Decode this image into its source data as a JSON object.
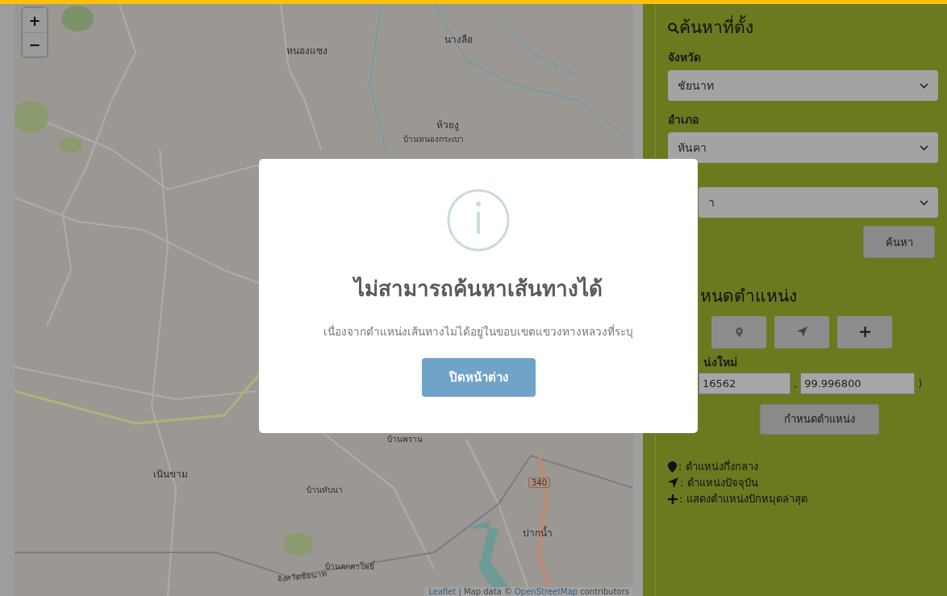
{
  "map": {
    "zoom_controls": [
      "+",
      "−"
    ],
    "labels": [
      {
        "kind": "town",
        "text": "หนองแซง"
      },
      {
        "kind": "town",
        "text": "นางลือ"
      },
      {
        "kind": "town",
        "text": "ห้วยงู"
      },
      {
        "kind": "village",
        "text": "บ้านหนองกระเบา"
      },
      {
        "kind": "town",
        "text": "เนินขาม"
      },
      {
        "kind": "village",
        "text": "บ้านพราน"
      },
      {
        "kind": "village",
        "text": "บ้านทับนา"
      },
      {
        "kind": "town",
        "text": "ปากน้ำ"
      },
      {
        "kind": "village",
        "text": "บ้านตกตาโพธิ์"
      },
      {
        "kind": "boundary",
        "text": "จังหวัดชัยนาท"
      },
      {
        "kind": "shield",
        "text": "340"
      }
    ],
    "attribution": {
      "library_link": "Leaflet",
      "text": "| Map data ©",
      "source_link": "OpenStreetMap",
      "suffix": "contributors"
    }
  },
  "search_panel": {
    "title": "ค้นหาที่ตั้ง",
    "fields": [
      {
        "kind": "select",
        "label": "จังหวัด",
        "value": "ชัยนาท"
      },
      {
        "kind": "select",
        "label": "อำเภอ",
        "value": "หันคา"
      },
      {
        "kind": "covered",
        "value": "า"
      }
    ],
    "search_button": "ค้นหา"
  },
  "position_panel": {
    "title": "หนดตำแหน่ง",
    "new_position_label": "น่งใหม่",
    "latitude": "16562",
    "separator": ",",
    "longitude": "99.996800",
    "closing": ")",
    "set_button": "กำหนดตำแหน่ง",
    "legend": [
      {
        "kind": "pin",
        "text": ": ตำแหน่งกึ่งกลาง"
      },
      {
        "kind": "navigation",
        "text": ": ตำแหน่งปัจจุบัน"
      },
      {
        "kind": "plus",
        "text": ": แสดงตำแหน่งปักหมุดล่าสุด"
      }
    ]
  },
  "dialog": {
    "title": "ไม่สามารถค้นหาเส้นทางได้",
    "message": "เนื่องจากตำแหน่งเส้นทางไม่ได้อยู่ในขอบเขตแขวงทางหลวงที่ระบุ",
    "close_button": "ปิดหน้าต่าง"
  }
}
